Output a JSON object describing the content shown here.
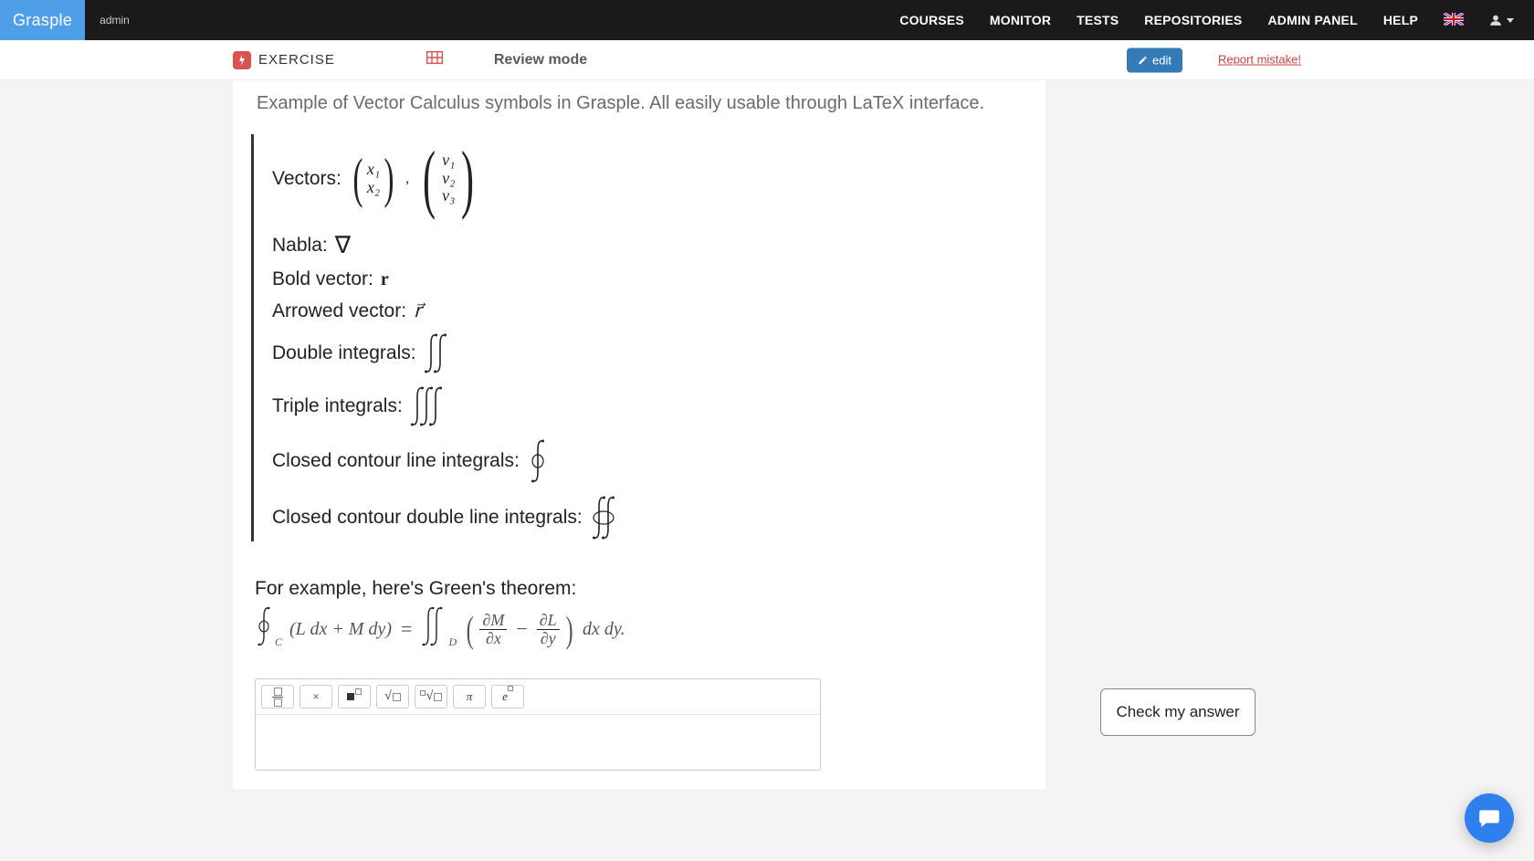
{
  "nav": {
    "brand": "Grasple",
    "admin": "admin",
    "links": [
      "COURSES",
      "MONITOR",
      "TESTS",
      "REPOSITORIES",
      "ADMIN PANEL",
      "HELP"
    ]
  },
  "subbar": {
    "exercise_label": "EXERCISE",
    "review_mode": "Review mode",
    "edit": "edit",
    "report": "Report mistake!"
  },
  "content": {
    "intro": "Example of Vector Calculus symbols in Grasple. All easily usable through LaTeX interface.",
    "lines": {
      "vectors_label": "Vectors:",
      "nabla_label": "Nabla:",
      "nabla_sym": "∇",
      "bold_label": "Bold vector:",
      "bold_sym": "r",
      "arrowed_label": "Arrowed vector:",
      "arrowed_sym": "r⃗",
      "double_int_label": "Double integrals:",
      "triple_int_label": "Triple integrals:",
      "closed_single_label": "Closed contour line integrals:",
      "closed_double_label": "Closed contour double line integrals:"
    },
    "vectors": {
      "v2": [
        "x₁",
        "x₂"
      ],
      "comma": ",",
      "v3": [
        "v₁",
        "v₂",
        "v₃"
      ]
    },
    "greens_intro": "For example, here's Green's theorem:",
    "greens": {
      "lhs_sub": "C",
      "lhs_inner": "(L dx + M dy)",
      "eq": "=",
      "rhs_sub": "D",
      "frac1_num": "∂M",
      "frac1_den": "∂x",
      "minus": "−",
      "frac2_num": "∂L",
      "frac2_den": "∂y",
      "tail": "dx dy."
    }
  },
  "toolbar": {
    "fraction_title": "fraction",
    "times_title": "times",
    "times_sym": "×",
    "power_title": "power",
    "sqrt_title": "square-root",
    "nthroot_title": "nth-root",
    "pi_title": "pi",
    "pi_sym": "π",
    "euler_title": "e-power"
  },
  "check": {
    "label": "Check my answer"
  }
}
